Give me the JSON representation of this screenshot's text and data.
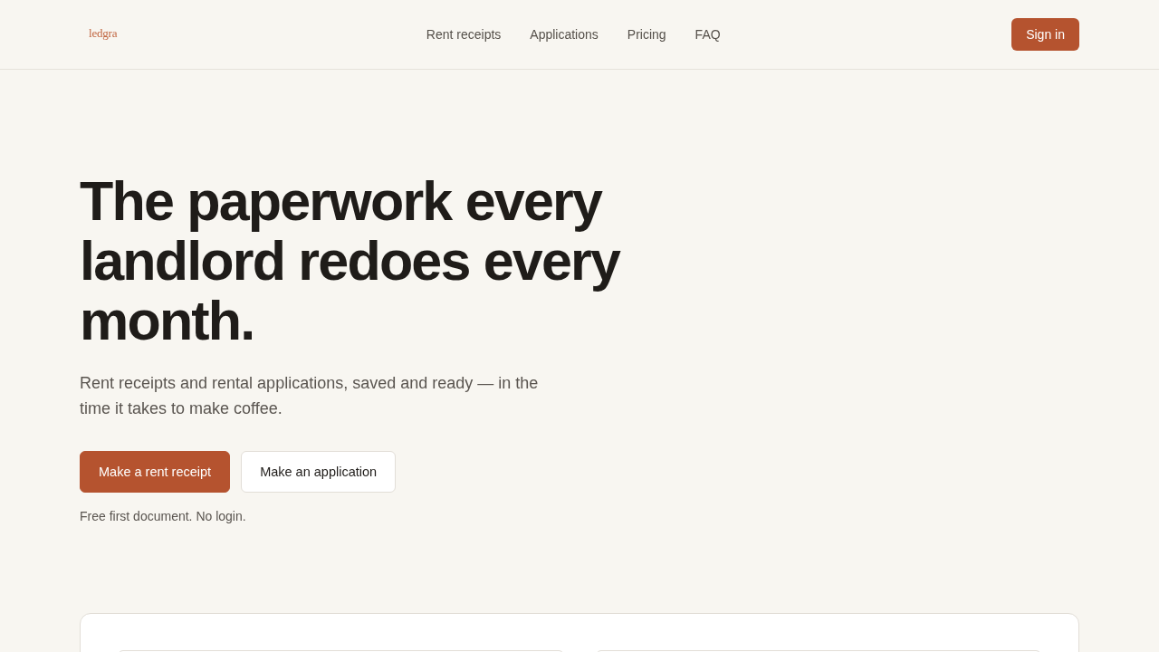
{
  "header": {
    "logo": "ledgra",
    "nav": [
      "Rent receipts",
      "Applications",
      "Pricing",
      "FAQ"
    ],
    "sign_in": "Sign in"
  },
  "hero": {
    "title": "The paperwork every landlord redoes every month.",
    "subtitle": "Rent receipts and rental applications, saved and ready — in the time it takes to make coffee.",
    "buttons": [
      {
        "label": "Make a rent receipt",
        "kind": "primary"
      },
      {
        "label": "Make an application",
        "kind": "secondary"
      }
    ],
    "note": "Free first document. No login."
  }
}
